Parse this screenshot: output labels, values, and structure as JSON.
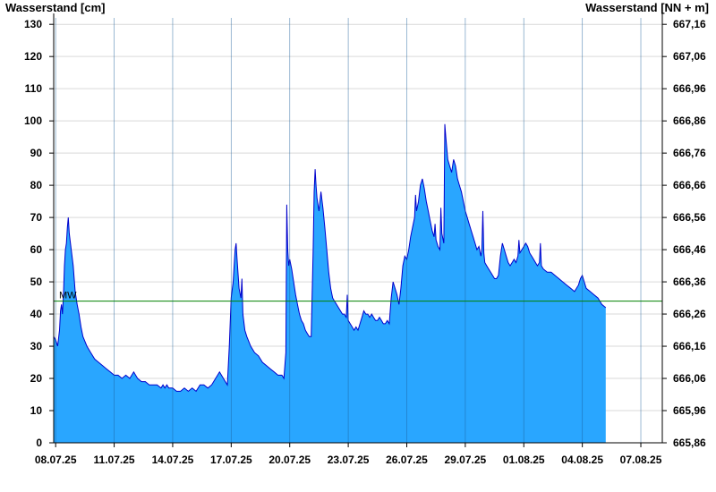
{
  "chart_data": {
    "type": "area",
    "ylabel_left": "Wasserstand [cm]",
    "ylabel_right": "Wasserstand [NN + m]",
    "ylim": [
      0,
      132
    ],
    "yticks_left": [
      "0",
      "10",
      "20",
      "30",
      "40",
      "50",
      "60",
      "70",
      "80",
      "90",
      "100",
      "110",
      "120",
      "130"
    ],
    "yticks_right": [
      "665,86",
      "665,96",
      "666,06",
      "666,16",
      "666,26",
      "666,36",
      "666,46",
      "666,56",
      "666,66",
      "666,76",
      "666,86",
      "666,96",
      "667,06",
      "667,16"
    ],
    "x_range_days": [
      0,
      31.2
    ],
    "xticks": [
      {
        "day": 0.1,
        "label": "08.07.25"
      },
      {
        "day": 3.1,
        "label": "11.07.25"
      },
      {
        "day": 6.1,
        "label": "14.07.25"
      },
      {
        "day": 9.1,
        "label": "17.07.25"
      },
      {
        "day": 12.1,
        "label": "20.07.25"
      },
      {
        "day": 15.1,
        "label": "23.07.25"
      },
      {
        "day": 18.1,
        "label": "26.07.25"
      },
      {
        "day": 21.1,
        "label": "29.07.25"
      },
      {
        "day": 24.1,
        "label": "01.08.25"
      },
      {
        "day": 27.1,
        "label": "04.08.25"
      },
      {
        "day": 30.1,
        "label": "07.08.25"
      }
    ],
    "reference_line": {
      "label": "MW",
      "value": 44,
      "color": "#008000"
    },
    "grid": true,
    "area_color": "#29A6FF",
    "line_color": "#0000CC",
    "series": [
      {
        "points": [
          [
            0.0,
            33
          ],
          [
            0.1,
            32
          ],
          [
            0.2,
            30
          ],
          [
            0.3,
            35
          ],
          [
            0.35,
            41
          ],
          [
            0.4,
            43
          ],
          [
            0.45,
            40
          ],
          [
            0.5,
            46
          ],
          [
            0.55,
            55
          ],
          [
            0.6,
            60
          ],
          [
            0.65,
            62
          ],
          [
            0.7,
            67
          ],
          [
            0.75,
            70
          ],
          [
            0.8,
            65
          ],
          [
            0.9,
            60
          ],
          [
            1.0,
            55
          ],
          [
            1.1,
            47
          ],
          [
            1.2,
            43
          ],
          [
            1.3,
            40
          ],
          [
            1.4,
            36
          ],
          [
            1.5,
            33
          ],
          [
            1.7,
            30
          ],
          [
            1.9,
            28
          ],
          [
            2.1,
            26
          ],
          [
            2.3,
            25
          ],
          [
            2.5,
            24
          ],
          [
            2.7,
            23
          ],
          [
            2.9,
            22
          ],
          [
            3.1,
            21
          ],
          [
            3.3,
            21
          ],
          [
            3.5,
            20
          ],
          [
            3.7,
            21
          ],
          [
            3.9,
            20
          ],
          [
            4.1,
            22
          ],
          [
            4.3,
            20
          ],
          [
            4.5,
            19
          ],
          [
            4.7,
            19
          ],
          [
            4.9,
            18
          ],
          [
            5.1,
            18
          ],
          [
            5.3,
            18
          ],
          [
            5.5,
            17
          ],
          [
            5.6,
            18
          ],
          [
            5.7,
            17
          ],
          [
            5.8,
            18
          ],
          [
            5.9,
            17
          ],
          [
            6.1,
            17
          ],
          [
            6.3,
            16
          ],
          [
            6.5,
            16
          ],
          [
            6.7,
            17
          ],
          [
            6.9,
            16
          ],
          [
            7.1,
            17
          ],
          [
            7.3,
            16
          ],
          [
            7.5,
            18
          ],
          [
            7.7,
            18
          ],
          [
            7.9,
            17
          ],
          [
            8.1,
            18
          ],
          [
            8.3,
            20
          ],
          [
            8.5,
            22
          ],
          [
            8.7,
            20
          ],
          [
            8.9,
            18
          ],
          [
            9.0,
            30
          ],
          [
            9.1,
            45
          ],
          [
            9.2,
            50
          ],
          [
            9.3,
            60
          ],
          [
            9.35,
            62
          ],
          [
            9.4,
            57
          ],
          [
            9.5,
            48
          ],
          [
            9.6,
            45
          ],
          [
            9.65,
            51
          ],
          [
            9.7,
            40
          ],
          [
            9.8,
            35
          ],
          [
            9.9,
            33
          ],
          [
            10.1,
            30
          ],
          [
            10.3,
            28
          ],
          [
            10.5,
            27
          ],
          [
            10.7,
            25
          ],
          [
            10.9,
            24
          ],
          [
            11.1,
            23
          ],
          [
            11.3,
            22
          ],
          [
            11.5,
            21
          ],
          [
            11.7,
            21
          ],
          [
            11.8,
            20
          ],
          [
            11.9,
            28
          ],
          [
            11.95,
            74
          ],
          [
            12.0,
            60
          ],
          [
            12.05,
            55
          ],
          [
            12.1,
            57
          ],
          [
            12.2,
            54
          ],
          [
            12.3,
            50
          ],
          [
            12.4,
            46
          ],
          [
            12.5,
            43
          ],
          [
            12.6,
            40
          ],
          [
            12.7,
            38
          ],
          [
            12.8,
            37
          ],
          [
            12.9,
            35
          ],
          [
            13.0,
            34
          ],
          [
            13.1,
            33
          ],
          [
            13.2,
            33
          ],
          [
            13.3,
            60
          ],
          [
            13.35,
            78
          ],
          [
            13.4,
            85
          ],
          [
            13.45,
            80
          ],
          [
            13.5,
            76
          ],
          [
            13.6,
            72
          ],
          [
            13.65,
            75
          ],
          [
            13.7,
            78
          ],
          [
            13.8,
            73
          ],
          [
            13.9,
            67
          ],
          [
            14.0,
            60
          ],
          [
            14.1,
            53
          ],
          [
            14.2,
            48
          ],
          [
            14.3,
            45
          ],
          [
            14.4,
            44
          ],
          [
            14.5,
            43
          ],
          [
            14.6,
            42
          ],
          [
            14.7,
            41
          ],
          [
            14.8,
            40
          ],
          [
            14.9,
            40
          ],
          [
            15.0,
            39
          ],
          [
            15.05,
            46
          ],
          [
            15.1,
            38
          ],
          [
            15.2,
            37
          ],
          [
            15.3,
            36
          ],
          [
            15.4,
            35
          ],
          [
            15.5,
            36
          ],
          [
            15.6,
            35
          ],
          [
            15.7,
            37
          ],
          [
            15.8,
            39
          ],
          [
            15.9,
            41
          ],
          [
            16.0,
            40
          ],
          [
            16.1,
            40
          ],
          [
            16.2,
            39
          ],
          [
            16.3,
            40
          ],
          [
            16.4,
            39
          ],
          [
            16.5,
            38
          ],
          [
            16.6,
            38
          ],
          [
            16.7,
            39
          ],
          [
            16.8,
            38
          ],
          [
            16.9,
            37
          ],
          [
            17.0,
            37
          ],
          [
            17.1,
            38
          ],
          [
            17.2,
            37
          ],
          [
            17.3,
            45
          ],
          [
            17.4,
            50
          ],
          [
            17.5,
            48
          ],
          [
            17.6,
            46
          ],
          [
            17.7,
            43
          ],
          [
            17.8,
            48
          ],
          [
            17.9,
            55
          ],
          [
            18.0,
            58
          ],
          [
            18.1,
            57
          ],
          [
            18.2,
            60
          ],
          [
            18.3,
            64
          ],
          [
            18.4,
            67
          ],
          [
            18.5,
            70
          ],
          [
            18.55,
            77
          ],
          [
            18.6,
            72
          ],
          [
            18.7,
            75
          ],
          [
            18.8,
            80
          ],
          [
            18.9,
            82
          ],
          [
            19.0,
            79
          ],
          [
            19.1,
            75
          ],
          [
            19.2,
            72
          ],
          [
            19.3,
            69
          ],
          [
            19.4,
            66
          ],
          [
            19.5,
            64
          ],
          [
            19.55,
            68
          ],
          [
            19.6,
            63
          ],
          [
            19.7,
            61
          ],
          [
            19.8,
            60
          ],
          [
            19.85,
            73
          ],
          [
            19.9,
            65
          ],
          [
            20.0,
            62
          ],
          [
            20.05,
            99
          ],
          [
            20.1,
            95
          ],
          [
            20.2,
            88
          ],
          [
            20.3,
            86
          ],
          [
            20.4,
            84
          ],
          [
            20.5,
            88
          ],
          [
            20.6,
            86
          ],
          [
            20.7,
            82
          ],
          [
            20.8,
            80
          ],
          [
            20.9,
            78
          ],
          [
            21.0,
            75
          ],
          [
            21.1,
            72
          ],
          [
            21.2,
            70
          ],
          [
            21.3,
            68
          ],
          [
            21.4,
            66
          ],
          [
            21.5,
            64
          ],
          [
            21.6,
            62
          ],
          [
            21.7,
            60
          ],
          [
            21.8,
            61
          ],
          [
            21.9,
            58
          ],
          [
            21.95,
            60
          ],
          [
            22.0,
            72
          ],
          [
            22.05,
            59
          ],
          [
            22.1,
            56
          ],
          [
            22.2,
            55
          ],
          [
            22.3,
            54
          ],
          [
            22.4,
            53
          ],
          [
            22.5,
            52
          ],
          [
            22.6,
            51
          ],
          [
            22.7,
            51
          ],
          [
            22.8,
            52
          ],
          [
            22.9,
            58
          ],
          [
            23.0,
            62
          ],
          [
            23.1,
            60
          ],
          [
            23.2,
            58
          ],
          [
            23.3,
            56
          ],
          [
            23.4,
            55
          ],
          [
            23.5,
            56
          ],
          [
            23.6,
            57
          ],
          [
            23.7,
            56
          ],
          [
            23.8,
            58
          ],
          [
            23.85,
            63
          ],
          [
            23.9,
            59
          ],
          [
            24.0,
            60
          ],
          [
            24.1,
            61
          ],
          [
            24.2,
            62
          ],
          [
            24.3,
            61
          ],
          [
            24.4,
            59
          ],
          [
            24.5,
            58
          ],
          [
            24.6,
            57
          ],
          [
            24.7,
            56
          ],
          [
            24.8,
            55
          ],
          [
            24.9,
            56
          ],
          [
            24.95,
            62
          ],
          [
            25.0,
            55
          ],
          [
            25.1,
            54
          ],
          [
            25.3,
            53
          ],
          [
            25.5,
            53
          ],
          [
            25.7,
            52
          ],
          [
            25.9,
            51
          ],
          [
            26.1,
            50
          ],
          [
            26.3,
            49
          ],
          [
            26.5,
            48
          ],
          [
            26.7,
            47
          ],
          [
            26.9,
            49
          ],
          [
            27.0,
            51
          ],
          [
            27.1,
            52
          ],
          [
            27.2,
            50
          ],
          [
            27.3,
            48
          ],
          [
            27.5,
            47
          ],
          [
            27.7,
            46
          ],
          [
            27.9,
            45
          ],
          [
            28.0,
            44
          ],
          [
            28.1,
            43
          ],
          [
            28.3,
            42
          ]
        ]
      }
    ]
  }
}
